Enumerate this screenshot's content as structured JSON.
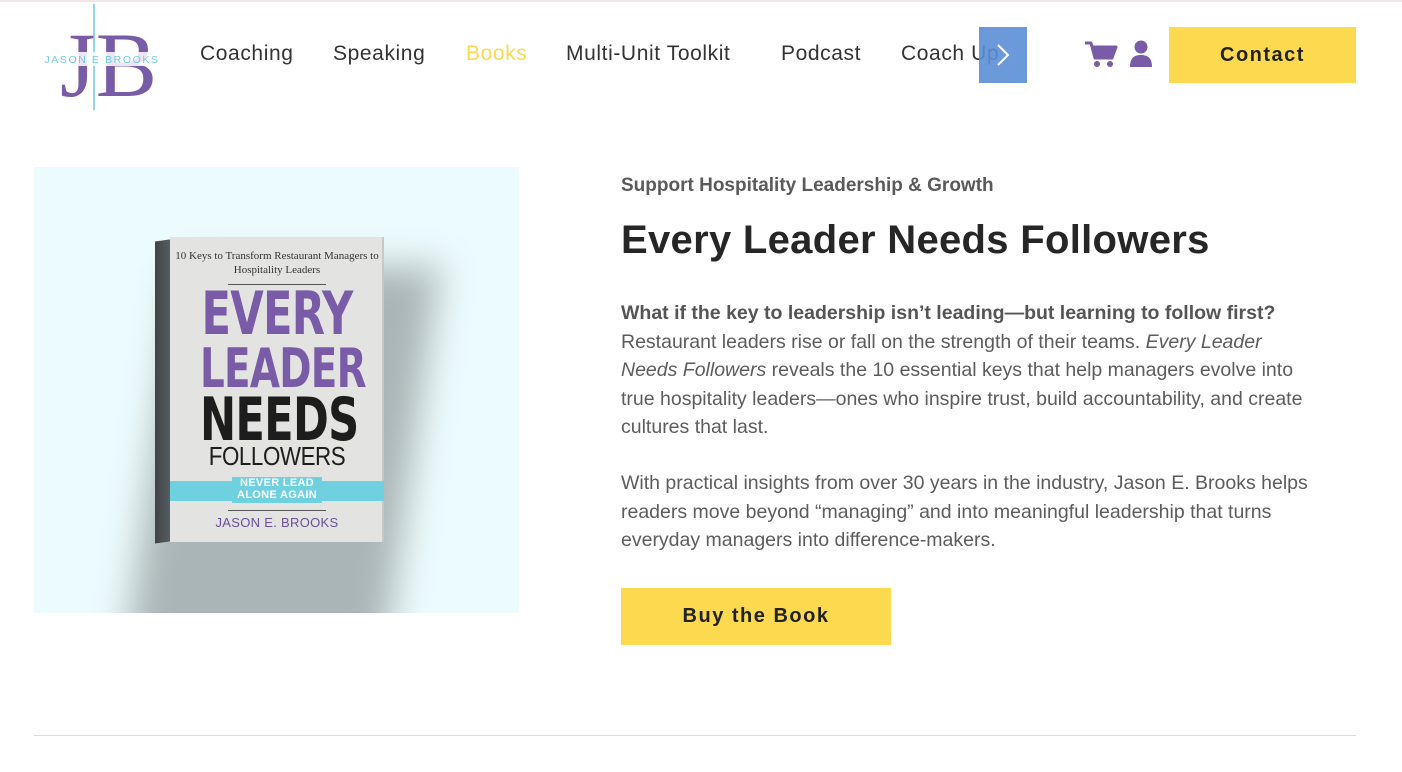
{
  "header": {
    "logo_initials": "JB",
    "logo_name": "JASON E BROOKS",
    "nav": [
      {
        "label": "Coaching",
        "active": false
      },
      {
        "label": "Speaking",
        "active": false
      },
      {
        "label": "Books",
        "active": true
      },
      {
        "label": "Multi-Unit Toolkit",
        "active": false
      },
      {
        "label": "Podcast",
        "active": false
      },
      {
        "label": "Coach Up",
        "active": false
      }
    ],
    "scroll_icon": "chevron-right-icon",
    "cart_icon": "cart-icon",
    "account_icon": "user-icon",
    "contact_label": "Contact"
  },
  "book_cover": {
    "tagline_top": "10 Keys to Transform Restaurant Managers to Hospitality Leaders",
    "word1": "EVERY",
    "word2": "LEADER",
    "word3": "NEEDS",
    "word4": "FOLLOWERS",
    "subtitle": "NEVER LEAD ALONE AGAIN",
    "author": "JASON E. BROOKS"
  },
  "main": {
    "kicker": "Support Hospitality Leadership & Growth",
    "title": "Every Leader Needs Followers",
    "lead_question": "What if the key to leadership isn’t leading—but learning to follow first?",
    "para1_a": "Restaurant leaders rise or fall on the strength of their teams. ",
    "para1_italic": "Every Leader Needs Followers",
    "para1_b": " reveals the 10 essential keys that help managers evolve into true hospitality leaders—ones who inspire trust, build accountability, and create cultures that last.",
    "para2": "With practical insights from over 30 years in the industry, Jason E. Brooks helps readers move beyond “managing” and into meaningful leadership that turns everyday managers into difference-makers.",
    "buy_label": "Buy the Book"
  },
  "colors": {
    "accent_yellow": "#fdd94f",
    "brand_purple": "#7a5ba8",
    "panel_bg": "#ecfbfd",
    "teal": "#6fd1df"
  }
}
